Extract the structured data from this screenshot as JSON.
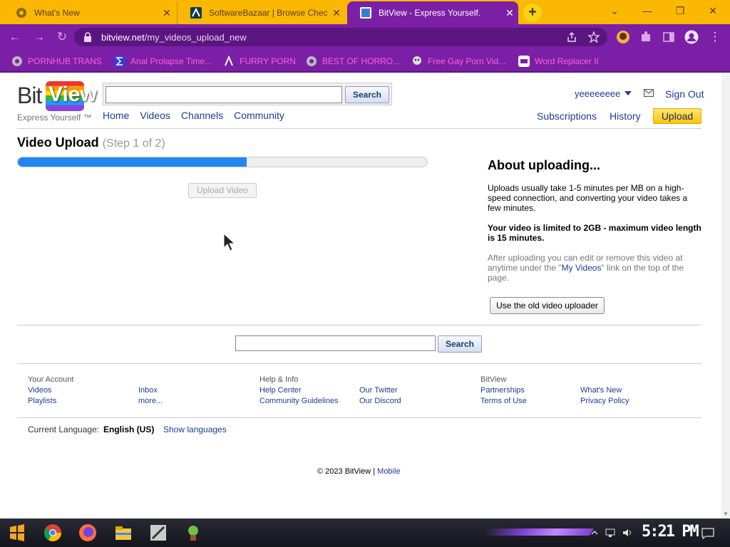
{
  "browser": {
    "tabs": [
      {
        "title": "What's New",
        "active": false
      },
      {
        "title": "SoftwareBazaar | Browse Chec",
        "active": false
      },
      {
        "title": "BitView - Express Yourself.",
        "active": true
      }
    ],
    "new_tab_label": "+",
    "url_domain": "bitview.net",
    "url_path": "/my_videos_upload_new",
    "bookmarks": [
      "PORNHUB TRANS",
      "Anal Prolapse Time...",
      "FURRY PORN",
      "BEST OF HORRO...",
      "Free Gay Porn Vid...",
      "Word Replacer II"
    ],
    "theme_colors": {
      "tab_strip": "#fab802",
      "toolbar": "#7b1fa6"
    }
  },
  "site": {
    "logo_bit": "Bit",
    "logo_view": "View",
    "tagline": "Express Yourself ™",
    "search_button": "Search",
    "nav": [
      "Home",
      "Videos",
      "Channels",
      "Community"
    ],
    "username": "yeeeeeeee",
    "sign_out": "Sign Out",
    "subscriptions": "Subscriptions",
    "history": "History",
    "upload": "Upload"
  },
  "upload": {
    "title": "Video Upload",
    "step": "(Step 1 of 2)",
    "progress_fraction": 0.56,
    "upload_button": "Upload Video"
  },
  "about": {
    "heading": "About uploading...",
    "p1": "Uploads usually take 1-5 minutes per MB on a high-speed connection, and converting your video takes a few minutes.",
    "p2": "Your video is limited to 2GB - maximum video length is 15 minutes.",
    "p3_before": "After uploading you can edit or remove this video at anytime under the \"",
    "p3_link": "My Videos",
    "p3_after": "\" link on the top of the page.",
    "old_uploader": "Use the old video uploader"
  },
  "footer": {
    "search_button": "Search",
    "col1_heading": "Your Account",
    "col1_links": [
      "Videos",
      "Playlists"
    ],
    "col1b_links": [
      "Inbox",
      "more..."
    ],
    "col2_heading": "Help & Info",
    "col2_links": [
      "Help Center",
      "Community Guidelines"
    ],
    "col2b_links": [
      "Our Twitter",
      "Our Discord"
    ],
    "col3_heading": "BitView",
    "col3_links": [
      "Partnerships",
      "Terms of Use"
    ],
    "col3b_links": [
      "What's New",
      "Privacy Policy"
    ],
    "language_label": "Current Language:",
    "language_value": "English (US)",
    "show_languages": "Show languages",
    "copyright": "© 2023 BitView |",
    "mobile": "Mobile"
  },
  "taskbar": {
    "clock": "5:21 PM"
  }
}
